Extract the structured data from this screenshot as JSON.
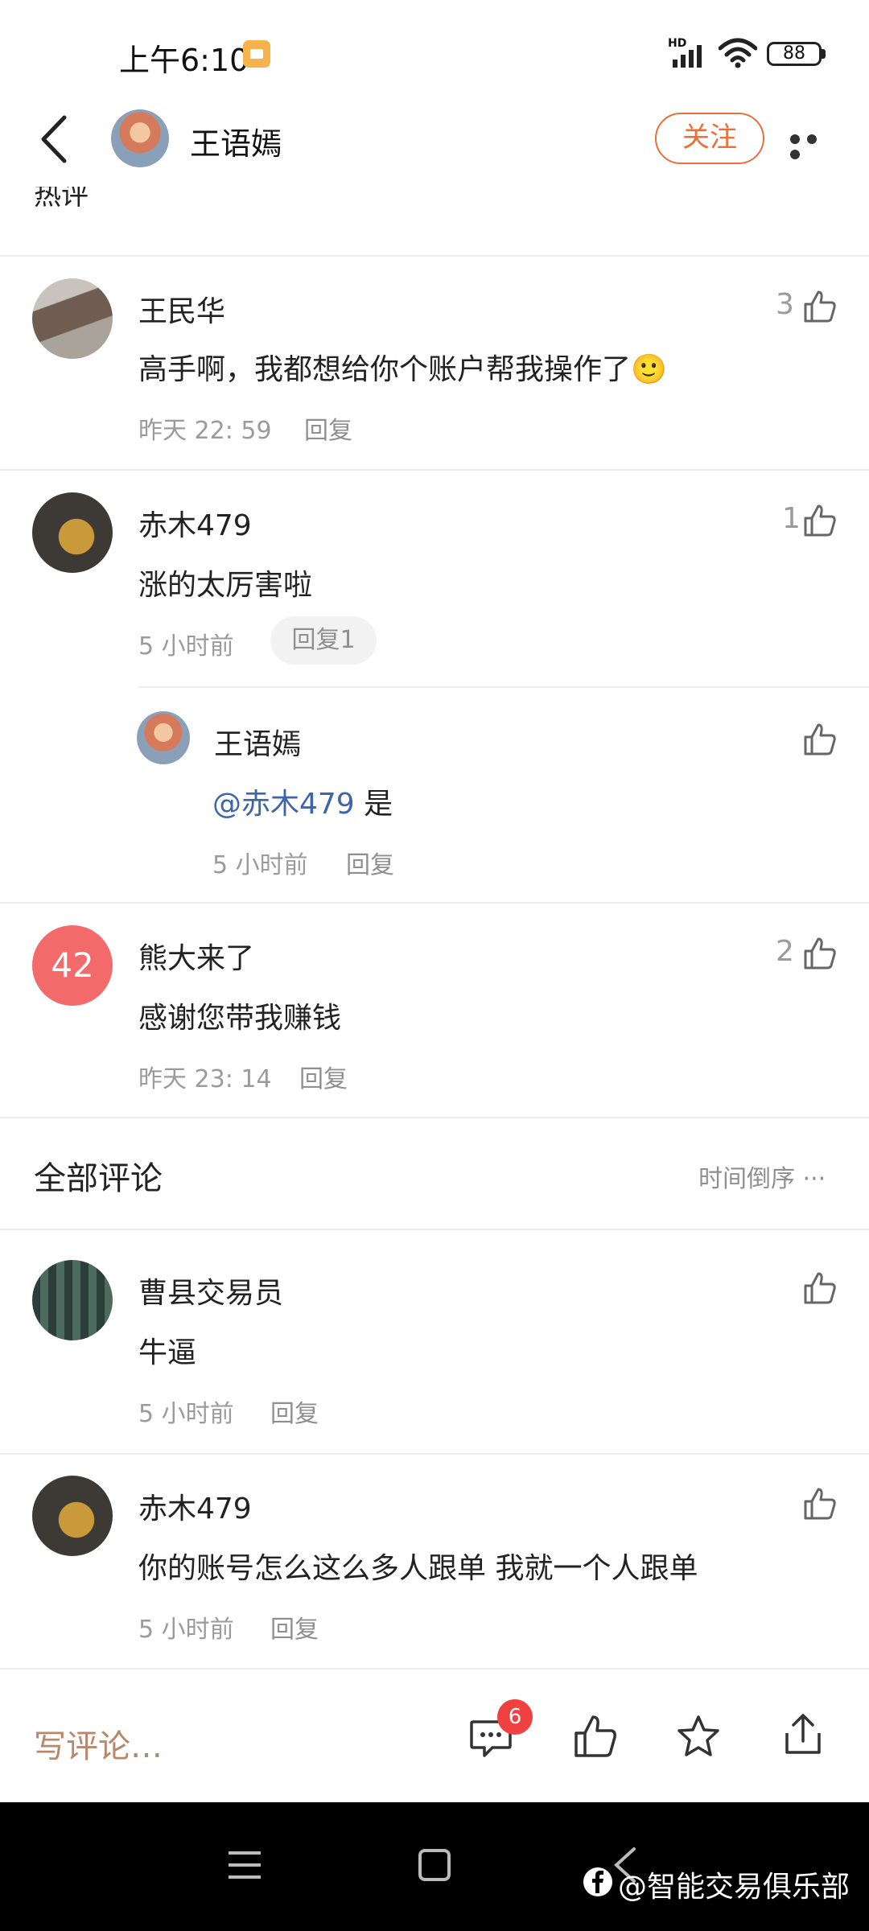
{
  "status_bar": {
    "time": "上午6:10",
    "hd": "HD",
    "battery": "88"
  },
  "header": {
    "name": "王语嫣",
    "follow_label": "关注"
  },
  "section_cut_label": "热评",
  "hot_comments": [
    {
      "name": "王民华",
      "text": "高手啊，我都想给你个账户帮我操作了🙂",
      "time": "昨天 22: 59",
      "reply": "回复",
      "likes": "3"
    },
    {
      "name": "赤木479",
      "text": "涨的太厉害啦",
      "time": "5 小时前",
      "reply": "回复1",
      "likes": "1",
      "sub_reply": {
        "name": "王语嫣",
        "mention": "@赤木479",
        "text": "是",
        "time": "5 小时前",
        "reply": "回复"
      }
    },
    {
      "name": "熊大来了",
      "avatar_text": "42",
      "text": "感谢您带我赚钱",
      "time": "昨天 23: 14",
      "reply": "回复",
      "likes": "2"
    }
  ],
  "all_comments_title": "全部评论",
  "sort_label": "时间倒序 ···",
  "all_comments": [
    {
      "name": "曹县交易员",
      "text": "牛逼",
      "time": "5 小时前",
      "reply": "回复"
    },
    {
      "name": "赤木479",
      "text": "你的账号怎么这么多人跟单 我就一个人跟单",
      "time": "5 小时前",
      "reply": "回复"
    }
  ],
  "bottom_bar": {
    "write_placeholder": "写评论…",
    "comment_count": "6"
  },
  "watermark": "@智能交易俱乐部",
  "colors": {
    "accent": "#e8703a",
    "mention": "#3d65a8",
    "badge": "#f04141",
    "avatar_badge": "#f26a6a"
  }
}
